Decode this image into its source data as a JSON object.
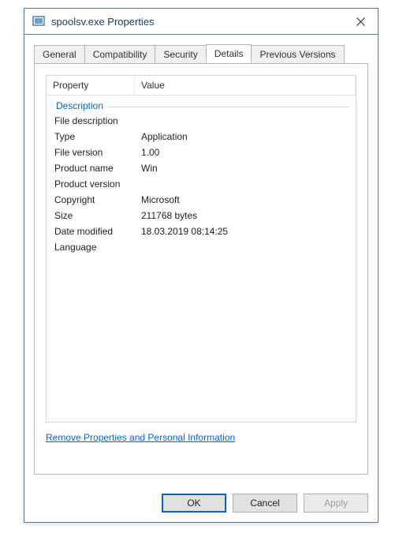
{
  "window": {
    "title": "spoolsv.exe Properties"
  },
  "tabs": {
    "general": "General",
    "compatibility": "Compatibility",
    "security": "Security",
    "details": "Details",
    "previous": "Previous Versions"
  },
  "listview": {
    "header_property": "Property",
    "header_value": "Value",
    "group_description": "Description",
    "rows": {
      "file_description": {
        "label": "File description",
        "value": ""
      },
      "type": {
        "label": "Type",
        "value": "Application"
      },
      "file_version": {
        "label": "File version",
        "value": "1.00"
      },
      "product_name": {
        "label": "Product name",
        "value": "Win"
      },
      "product_version": {
        "label": "Product version",
        "value": ""
      },
      "copyright": {
        "label": "Copyright",
        "value": "Microsoft"
      },
      "size": {
        "label": "Size",
        "value": "211768 bytes"
      },
      "date_modified": {
        "label": "Date modified",
        "value": "18.03.2019 08:14:25"
      },
      "language": {
        "label": "Language",
        "value": ""
      }
    }
  },
  "link_remove": "Remove Properties and Personal Information",
  "buttons": {
    "ok": "OK",
    "cancel": "Cancel",
    "apply": "Apply"
  },
  "watermark": {
    "line1": "",
    "line2": "",
    "line3": ""
  }
}
